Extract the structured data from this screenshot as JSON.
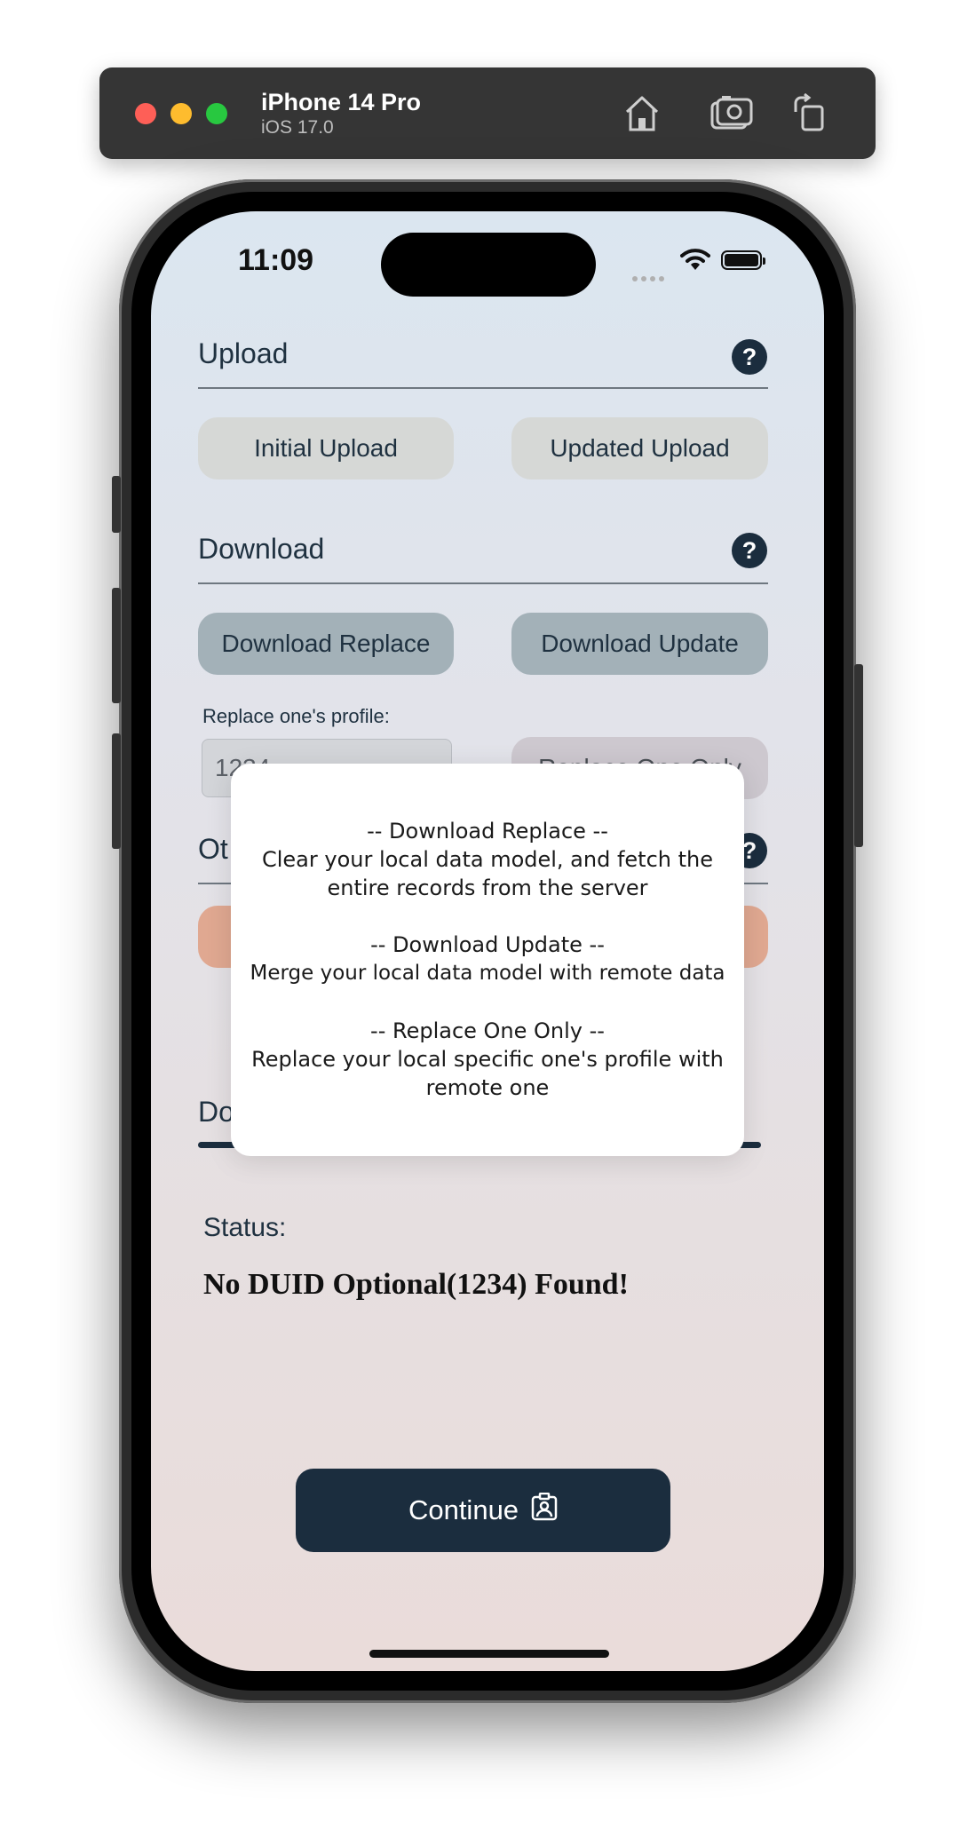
{
  "simulator": {
    "device": "iPhone 14 Pro",
    "os": "iOS 17.0"
  },
  "status_bar": {
    "time": "11:09"
  },
  "upload": {
    "title": "Upload",
    "help": "?",
    "initial_label": "Initial Upload",
    "updated_label": "Updated Upload"
  },
  "download": {
    "title": "Download",
    "help": "?",
    "replace_label": "Download Replace",
    "update_label": "Download Update"
  },
  "replace_one": {
    "label": "Replace one's profile:",
    "input_value": "1234",
    "button_label": "Replace One Only"
  },
  "other": {
    "title_partial": "Ot",
    "help": "?"
  },
  "lower_section": {
    "title_partial": "Do"
  },
  "status": {
    "label": "Status:",
    "message": "No DUID Optional(1234) Found!"
  },
  "continue": {
    "label": "Continue"
  },
  "popover": {
    "heading1": "-- Download Replace --",
    "body1_line1": "Clear your local data model, and fetch the",
    "body1_line2": "entire records from the server",
    "heading2": "-- Download Update --",
    "body2": "Merge your local data model with remote data",
    "heading3": "-- Replace One Only --",
    "body3_line1": "Replace your local specific one's profile with",
    "body3_line2": "remote one"
  },
  "colors": {
    "navy": "#1b2d3e",
    "gray_button": "#d6d8d6",
    "slate_button": "#a3b1b8",
    "salmon_button": "#e0a891"
  }
}
